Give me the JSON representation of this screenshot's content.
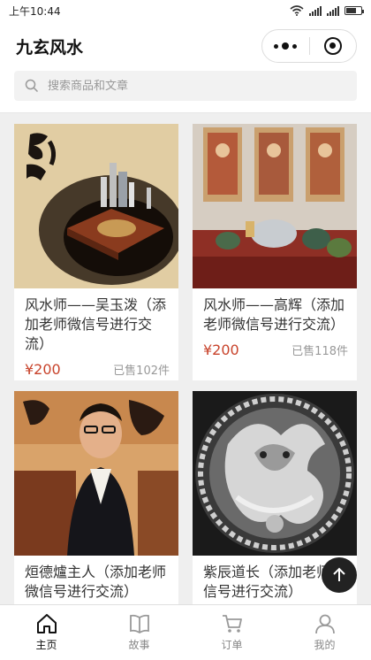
{
  "status_bar": {
    "time": "上午10:44"
  },
  "nav": {
    "title": "九玄风水"
  },
  "search": {
    "placeholder": "搜索商品和文章"
  },
  "products": [
    {
      "title": "风水师——吴玉泼（添加老师微信号进行交流）",
      "price": "¥200",
      "sold": "已售102件",
      "image": "fengshui-compass-painting"
    },
    {
      "title": "风水师——高辉（添加老师微信号进行交流）",
      "price": "¥200",
      "sold": "已售118件",
      "image": "altar-with-deity-scrolls"
    },
    {
      "title": "烜德爐主人（添加老师微信号进行交流）",
      "image": "man-portrait-calligraphy"
    },
    {
      "title": "紫辰道长（添加老师微信号进行交流）",
      "image": "carved-dragon-medallion"
    }
  ],
  "tabs": [
    {
      "label": "主页",
      "icon": "home-icon",
      "active": true
    },
    {
      "label": "故事",
      "icon": "book-icon",
      "active": false
    },
    {
      "label": "订单",
      "icon": "cart-icon",
      "active": false
    },
    {
      "label": "我的",
      "icon": "user-icon",
      "active": false
    }
  ],
  "colors": {
    "price": "#c8432b",
    "accent": "#111111"
  }
}
